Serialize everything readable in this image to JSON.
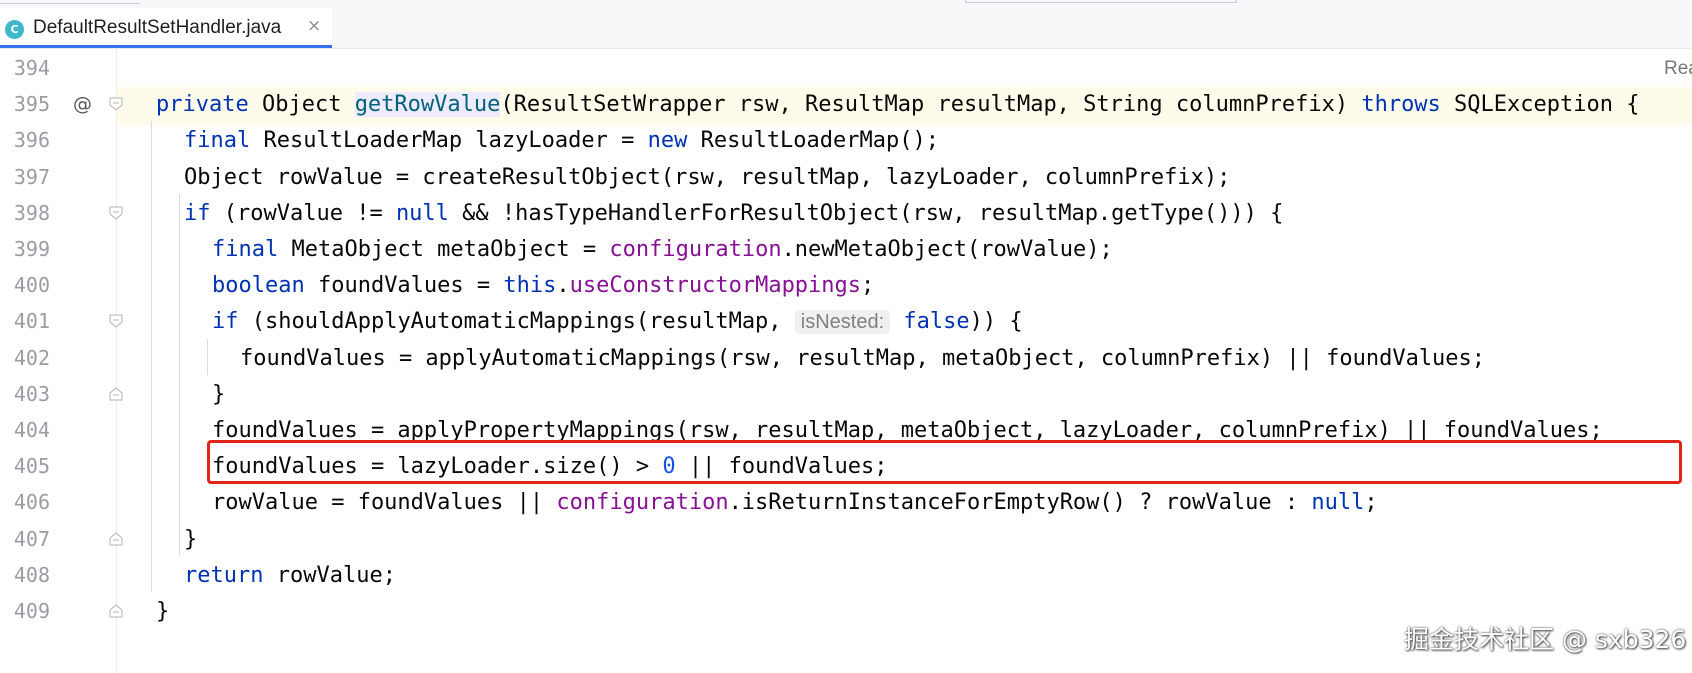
{
  "editor": {
    "tab": {
      "icon_letter": "C",
      "filename": "DefaultResultSetHandler.java",
      "close_glyph": "×"
    },
    "reader_mode_label": "Rea",
    "gutter_marker": "@",
    "watermark": "掘金技术社区 @ sxb326",
    "highlighted_line": "404",
    "lines": [
      {
        "num": "394",
        "indent": 0,
        "tokens": []
      },
      {
        "num": "395",
        "indent": 0,
        "tokens": [
          {
            "t": "private",
            "c": "kw"
          },
          {
            "t": " Object "
          },
          {
            "t": "getRowValue",
            "c": "decl-hl"
          },
          {
            "t": "(ResultSetWrapper rsw, ResultMap resultMap, String columnPrefix) "
          },
          {
            "t": "throws",
            "c": "kw"
          },
          {
            "t": " SQLException {"
          }
        ]
      },
      {
        "num": "396",
        "indent": 1,
        "tokens": [
          {
            "t": "final",
            "c": "kw"
          },
          {
            "t": " ResultLoaderMap lazyLoader = "
          },
          {
            "t": "new",
            "c": "kw"
          },
          {
            "t": " ResultLoaderMap();"
          }
        ]
      },
      {
        "num": "397",
        "indent": 1,
        "tokens": [
          {
            "t": "Object rowValue = createResultObject(rsw, resultMap, lazyLoader, columnPrefix);"
          }
        ]
      },
      {
        "num": "398",
        "indent": 1,
        "tokens": [
          {
            "t": "if",
            "c": "kw"
          },
          {
            "t": " (rowValue != "
          },
          {
            "t": "null",
            "c": "kw"
          },
          {
            "t": " && !hasTypeHandlerForResultObject(rsw, resultMap.getType())) {"
          }
        ]
      },
      {
        "num": "399",
        "indent": 2,
        "tokens": [
          {
            "t": "final",
            "c": "kw"
          },
          {
            "t": " MetaObject metaObject = "
          },
          {
            "t": "configuration",
            "c": "field"
          },
          {
            "t": ".newMetaObject(rowValue);"
          }
        ]
      },
      {
        "num": "400",
        "indent": 2,
        "tokens": [
          {
            "t": "boolean",
            "c": "kw"
          },
          {
            "t": " foundValues = "
          },
          {
            "t": "this",
            "c": "kw"
          },
          {
            "t": "."
          },
          {
            "t": "useConstructorMappings",
            "c": "field"
          },
          {
            "t": ";"
          }
        ]
      },
      {
        "num": "401",
        "indent": 2,
        "tokens": [
          {
            "t": "if",
            "c": "kw"
          },
          {
            "t": " (shouldApplyAutomaticMappings(resultMap, "
          },
          {
            "t": "isNested:",
            "c": "hint"
          },
          {
            "t": " "
          },
          {
            "t": "false",
            "c": "kw"
          },
          {
            "t": ")) {"
          }
        ]
      },
      {
        "num": "402",
        "indent": 3,
        "tokens": [
          {
            "t": "foundValues = applyAutomaticMappings(rsw, resultMap, metaObject, columnPrefix) || foundValues;"
          }
        ]
      },
      {
        "num": "403",
        "indent": 2,
        "tokens": [
          {
            "t": "}"
          }
        ]
      },
      {
        "num": "404",
        "indent": 2,
        "tokens": [
          {
            "t": "foundValues = applyPropertyMappings(rsw, resultMap, metaObject, lazyLoader, columnPrefix) || foundValues;"
          }
        ]
      },
      {
        "num": "405",
        "indent": 2,
        "tokens": [
          {
            "t": "foundValues = lazyLoader.size() > "
          },
          {
            "t": "0",
            "c": "num"
          },
          {
            "t": " || foundValues;"
          }
        ]
      },
      {
        "num": "406",
        "indent": 2,
        "tokens": [
          {
            "t": "rowValue = foundValues || "
          },
          {
            "t": "configuration",
            "c": "field"
          },
          {
            "t": ".isReturnInstanceForEmptyRow() ? rowValue : "
          },
          {
            "t": "null",
            "c": "kw"
          },
          {
            "t": ";"
          }
        ]
      },
      {
        "num": "407",
        "indent": 1,
        "tokens": [
          {
            "t": "}"
          }
        ]
      },
      {
        "num": "408",
        "indent": 1,
        "tokens": [
          {
            "t": "return",
            "c": "kw"
          },
          {
            "t": " rowValue;"
          }
        ]
      },
      {
        "num": "409",
        "indent": 0,
        "tokens": [
          {
            "t": "}"
          }
        ]
      }
    ]
  }
}
